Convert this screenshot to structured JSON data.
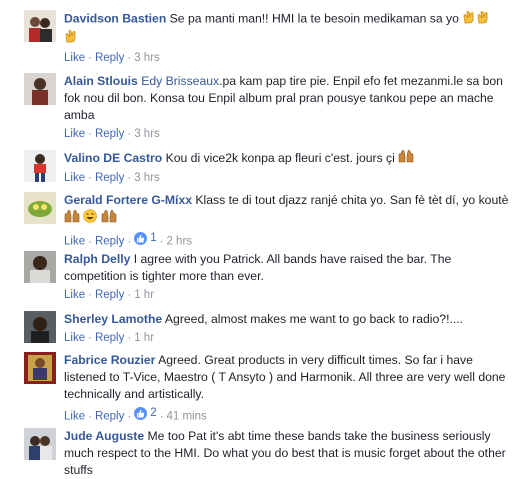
{
  "actions": {
    "like": "Like",
    "reply": "Reply",
    "sep": "·"
  },
  "colors": {
    "name_link": "#365899",
    "action_link": "#4267b2",
    "meta_gray": "#90949c",
    "like_badge": "#5890ff"
  },
  "comments": [
    {
      "author": "Davidson Bastien",
      "text": " Se pa manti man!! HMI la te besoin medikaman sa yo ",
      "time": "3 hrs",
      "emoji": [
        "clapping-hands-icon",
        "clapping-hands-icon",
        "clapping-hands-icon"
      ]
    },
    {
      "author": "Alain Stlouis",
      "mention": "Edy Brisseaux",
      "text": ".pa kam pap tire pie. Enpil efo fet mezanmi.le sa bon fok nou dil bon. Konsa tou Enpil album pral pran pousye tankou pepe an mache amba",
      "time": "3 hrs"
    },
    {
      "author": "Valino DE Castro",
      "text": " Kou di vice2k konpa ap fleuri c'est. jours çi ",
      "time": "3 hrs",
      "emoji": [
        "raised-hands-icon"
      ]
    },
    {
      "author": "Gerald Fortere G-Míxx",
      "text": " Klass te di tout djazz ranjé chita yo. San fè tèt dí, yo koutè ",
      "time": "2 hrs",
      "reactions": "1",
      "emoji": [
        "raised-hands-icon",
        "grinning-face-icon",
        "raised-hands-icon"
      ]
    },
    {
      "author": "Ralph Delly",
      "text": " I agree with you Patrick. All bands have raised the bar. The competition is tighter more than ever.",
      "time": "1 hr"
    },
    {
      "author": "Sherley Lamothe",
      "text": " Agreed, almost makes me want to go back to radio?!....",
      "time": "1 hr"
    },
    {
      "author": "Fabrice Rouzier",
      "text": " Agreed. Great products in very difficult times. So far i have listened to T-Vice, Maestro ( T Ansyto ) and Harmonik. All three are very well done technically and artistically.",
      "time": "41 mins",
      "reactions": "2"
    },
    {
      "author": "Jude Auguste",
      "text": " Me too Pat it's abt time these bands take the business seriously much respect to the HMI. Do what you do best that is music forget about the other stuffs"
    }
  ]
}
